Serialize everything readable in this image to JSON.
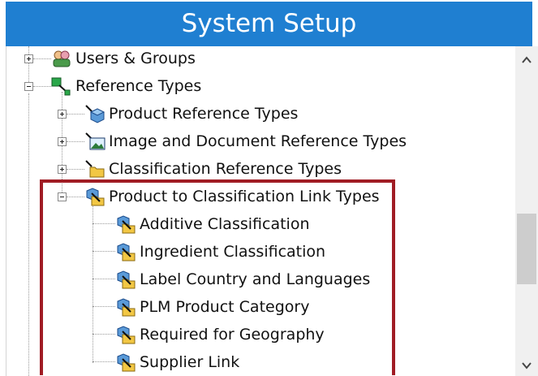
{
  "window": {
    "title": "System Setup"
  },
  "tree": {
    "items": [
      {
        "label": "Users & Groups",
        "icon": "users-groups-icon",
        "level": 0,
        "expander": "plus"
      },
      {
        "label": "Reference Types",
        "icon": "reference-types-icon",
        "level": 0,
        "expander": "minus"
      },
      {
        "label": "Product Reference Types",
        "icon": "product-reference-icon",
        "level": 1,
        "expander": "plus"
      },
      {
        "label": "Image and Document Reference Types",
        "icon": "image-document-icon",
        "level": 1,
        "expander": "plus"
      },
      {
        "label": "Classification Reference Types",
        "icon": "folder-reference-icon",
        "level": 1,
        "expander": "plus"
      },
      {
        "label": "Product to Classification Link Types",
        "icon": "link-type-icon",
        "level": 1,
        "expander": "minus"
      },
      {
        "label": "Additive Classification",
        "icon": "link-type-icon",
        "level": 2,
        "expander": "none"
      },
      {
        "label": "Ingredient Classification",
        "icon": "link-type-icon",
        "level": 2,
        "expander": "none"
      },
      {
        "label": "Label Country and Languages",
        "icon": "link-type-icon",
        "level": 2,
        "expander": "none"
      },
      {
        "label": "PLM Product Category",
        "icon": "link-type-icon",
        "level": 2,
        "expander": "none"
      },
      {
        "label": "Required for Geography",
        "icon": "link-type-icon",
        "level": 2,
        "expander": "none"
      },
      {
        "label": "Supplier Link",
        "icon": "link-type-icon",
        "level": 2,
        "expander": "none"
      }
    ]
  },
  "scrollbar": {
    "up_glyph": "^",
    "down_glyph": "v"
  },
  "colors": {
    "titlebar": "#1f7fd1",
    "highlight": "#a01c24"
  }
}
